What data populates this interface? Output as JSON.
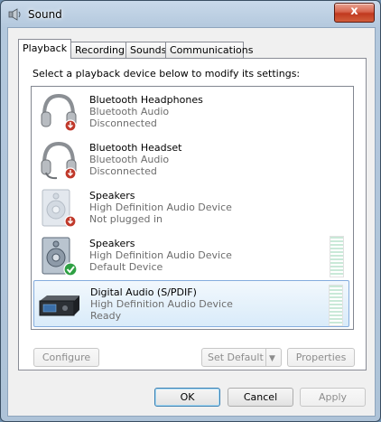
{
  "window": {
    "title": "Sound",
    "close_symbol": "x"
  },
  "tabs": [
    {
      "label": "Playback",
      "active": true
    },
    {
      "label": "Recording",
      "active": false
    },
    {
      "label": "Sounds",
      "active": false
    },
    {
      "label": "Communications",
      "active": false
    }
  ],
  "instruction": "Select a playback device below to modify its settings:",
  "devices": [
    {
      "name": "Bluetooth Headphones",
      "description": "Bluetooth Audio",
      "status": "Disconnected",
      "icon": "headphones-icon",
      "badge": "disconnected-badge"
    },
    {
      "name": "Bluetooth Headset",
      "description": "Bluetooth Audio",
      "status": "Disconnected",
      "icon": "headset-icon",
      "badge": "disconnected-badge"
    },
    {
      "name": "Speakers",
      "description": "High Definition Audio Device",
      "status": "Not plugged in",
      "icon": "speaker-icon",
      "badge": "unplugged-badge"
    },
    {
      "name": "Speakers",
      "description": "High Definition Audio Device",
      "status": "Default Device",
      "icon": "speaker-icon",
      "badge": "default-check-badge"
    },
    {
      "name": "Digital Audio (S/PDIF)",
      "description": "High Definition Audio Device",
      "status": "Ready",
      "icon": "digital-receiver-icon",
      "badge": "none"
    }
  ],
  "buttons": {
    "configure": "Configure",
    "set_default": "Set Default",
    "properties": "Properties",
    "ok": "OK",
    "cancel": "Cancel",
    "apply": "Apply"
  },
  "colors": {
    "selection_border": "#84acdd",
    "level_meter": "#c9e9d8",
    "close_red": "#c0391f"
  }
}
